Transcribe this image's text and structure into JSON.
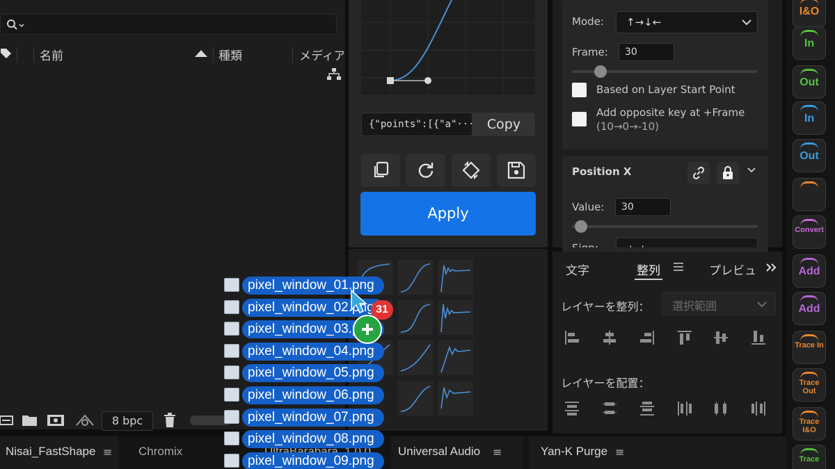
{
  "project_panel": {
    "columns": {
      "name": "名前",
      "type": "種類",
      "media": "メディア"
    },
    "bit_depth": "8 bpc"
  },
  "curve_panel": {
    "json_value": "{\"points\":[{\"a\"···",
    "copy_label": "Copy",
    "apply_label": "Apply",
    "tools": [
      "copy-icon",
      "refresh-icon",
      "flip-icon",
      "save-icon"
    ]
  },
  "settings": {
    "mode_label": "Mode:",
    "mode_value": "↑→↓←",
    "frame_label": "Frame:",
    "frame_value": "30",
    "frame_slider": 0.15,
    "check1_label": "Based on Layer Start Point",
    "check2_label": "Add opposite key at +Frame",
    "check2_sub": "(10→0→-10)",
    "posx_title": "Position X",
    "value_label": "Value:",
    "value_value": "30",
    "value_slider": 0.05,
    "sign_label": "Sign:",
    "sign_value": "+ +"
  },
  "align_panel": {
    "tabs": [
      "文字",
      "整列",
      "プレビュ"
    ],
    "align_label": "レイヤーを整列：",
    "align_target": "選択範囲",
    "distribute_label": "レイヤーを配置："
  },
  "strip": [
    {
      "text": "I&O",
      "color": "#e8892e",
      "icon": "ease-io-icon"
    },
    {
      "text": "In",
      "color": "#57c240",
      "icon": "ease-in-icon"
    },
    {
      "text": "Out",
      "color": "#57c240",
      "icon": "ease-out-icon"
    },
    {
      "text": "In",
      "color": "#3a9be0",
      "icon": "bounce-in-icon"
    },
    {
      "text": "Out",
      "color": "#3a9be0",
      "icon": "bounce-out-icon"
    },
    {
      "text": "",
      "color": "#e8892e",
      "icon": "swap-icon"
    },
    {
      "text": "Convert",
      "color": "#c86ad6",
      "icon": "convert-icon"
    },
    {
      "text": "Add",
      "color": "#b465d6",
      "icon": "add-lines-icon"
    },
    {
      "text": "Add",
      "color": "#b465d6",
      "icon": "add-columns-icon"
    },
    {
      "text": "Trace In",
      "color": "#e8892e",
      "icon": "trace-in-icon"
    },
    {
      "text": "Trace Out",
      "color": "#e8892e",
      "icon": "trace-out-icon"
    },
    {
      "text": "Trace I&O",
      "color": "#e8892e",
      "icon": "trace-io-icon"
    },
    {
      "text": "Trace",
      "color": "#57c240",
      "icon": "trace-icon"
    }
  ],
  "bottom_tabs": [
    {
      "label": "Nisai_FastShape"
    },
    {
      "label": "Chromix"
    },
    {
      "label": "UltraBarabara_1.0.0"
    },
    {
      "label": "Universal Audio"
    },
    {
      "label": "Yan-K Purge"
    }
  ],
  "drag": {
    "count_badge": "31",
    "files": [
      "pixel_window_01.png",
      "pixel_window_02.png",
      "pixel_window_03.png",
      "pixel_window_04.png",
      "pixel_window_05.png",
      "pixel_window_06.png",
      "pixel_window_07.png",
      "pixel_window_08.png",
      "pixel_window_09.png"
    ]
  }
}
